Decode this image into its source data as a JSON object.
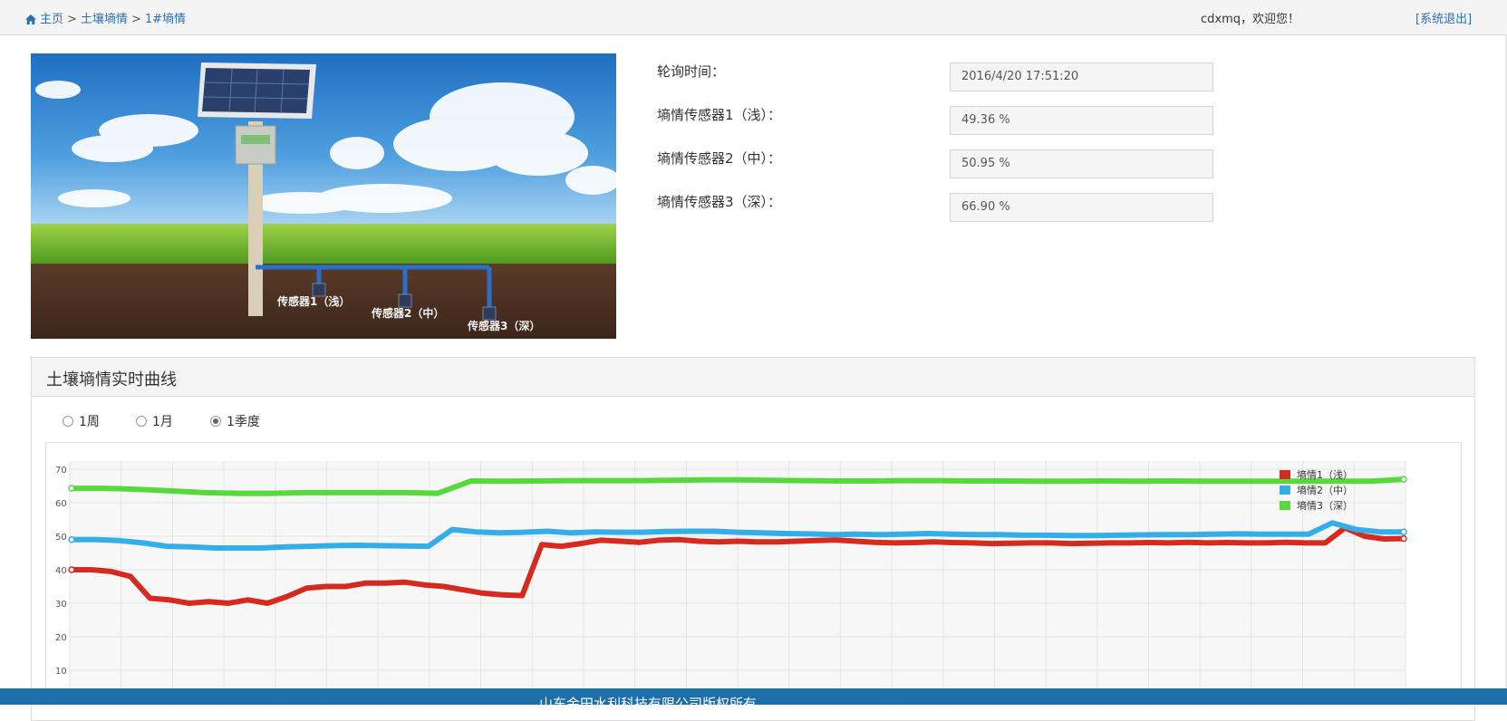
{
  "breadcrumb": {
    "home": "主页",
    "sep1": ">",
    "section": "土壤墒情",
    "sep2": ">",
    "current": "1#墒情"
  },
  "header": {
    "welcome": "cdxmq，欢迎您！",
    "logout": "[系统退出]"
  },
  "photo": {
    "sensor1_label": "传感器1（浅）",
    "sensor2_label": "传感器2（中）",
    "sensor3_label": "传感器3（深）"
  },
  "readings": [
    {
      "label": "轮询时间：",
      "value": "2016/4/20 17:51:20"
    },
    {
      "label": "墒情传感器1（浅）：",
      "value": "49.36 %"
    },
    {
      "label": "墒情传感器2（中）：",
      "value": "50.95 %"
    },
    {
      "label": "墒情传感器3（深）：",
      "value": "66.90 %"
    }
  ],
  "panel": {
    "title": "土壤墒情实时曲线",
    "options": [
      "1周",
      "1月",
      "1季度"
    ],
    "selected": "1季度"
  },
  "footer": {
    "copyright": "山东金田水利科技有限公司版权所有"
  },
  "colors": {
    "series1": "#d42a1f",
    "series2": "#33aee8",
    "series3": "#57d93e",
    "footer": "#1e6fa8",
    "link": "#2a6fb0"
  },
  "chart_data": {
    "type": "line",
    "yticks": [
      10,
      20,
      30,
      40,
      50,
      60,
      70
    ],
    "ylim": [
      10,
      70
    ],
    "legend_position": "top-right",
    "grid": true,
    "series": [
      {
        "name": "墒情1（浅）",
        "values": [
          40,
          40,
          39.5,
          38,
          31.5,
          31,
          30,
          30.5,
          30,
          31,
          30,
          32,
          34.5,
          35,
          35,
          36,
          36,
          36.3,
          35.5,
          35,
          34,
          33,
          32.5,
          32.3,
          47.5,
          47,
          47.8,
          48.8,
          48.5,
          48.2,
          48.8,
          49,
          48.5,
          48.3,
          48.5,
          48.3,
          48.3,
          48.5,
          48.7,
          48.9,
          48.5,
          48.2,
          48,
          48.1,
          48.3,
          48.1,
          48,
          47.8,
          47.9,
          48,
          48,
          47.8,
          47.9,
          48,
          48,
          48.1,
          48,
          48.2,
          48,
          48.1,
          48,
          48,
          48.2,
          48,
          48,
          52.5,
          50,
          49.2,
          49.3
        ]
      },
      {
        "name": "墒情2（中）",
        "values": [
          49,
          49,
          48.7,
          48,
          47,
          46.8,
          46.5,
          46.5,
          46.5,
          46.8,
          47,
          47.2,
          47.3,
          47.2,
          47.1,
          47,
          52,
          51.3,
          51,
          51.2,
          51.5,
          51,
          51.3,
          51.2,
          51.2,
          51.4,
          51.5,
          51.5,
          51.2,
          51,
          50.8,
          50.7,
          50.5,
          50.6,
          50.5,
          50.6,
          50.8,
          50.6,
          50.5,
          50.5,
          50.3,
          50.3,
          50.2,
          50.2,
          50.3,
          50.4,
          50.5,
          50.5,
          50.6,
          50.7,
          50.6,
          50.6,
          50.6,
          54,
          52,
          51.3,
          51.3
        ]
      },
      {
        "name": "墒情3（深）",
        "values": [
          64.3,
          64.3,
          64,
          63.5,
          63,
          62.8,
          62.8,
          63,
          63,
          63,
          63,
          62.8,
          66.5,
          66.4,
          66.5,
          66.6,
          66.6,
          66.6,
          66.7,
          66.8,
          66.8,
          66.7,
          66.6,
          66.5,
          66.5,
          66.6,
          66.6,
          66.5,
          66.5,
          66.4,
          66.4,
          66.5,
          66.4,
          66.5,
          66.4,
          66.4,
          66.4,
          66.4,
          66.4,
          66.4,
          67
        ]
      }
    ]
  }
}
